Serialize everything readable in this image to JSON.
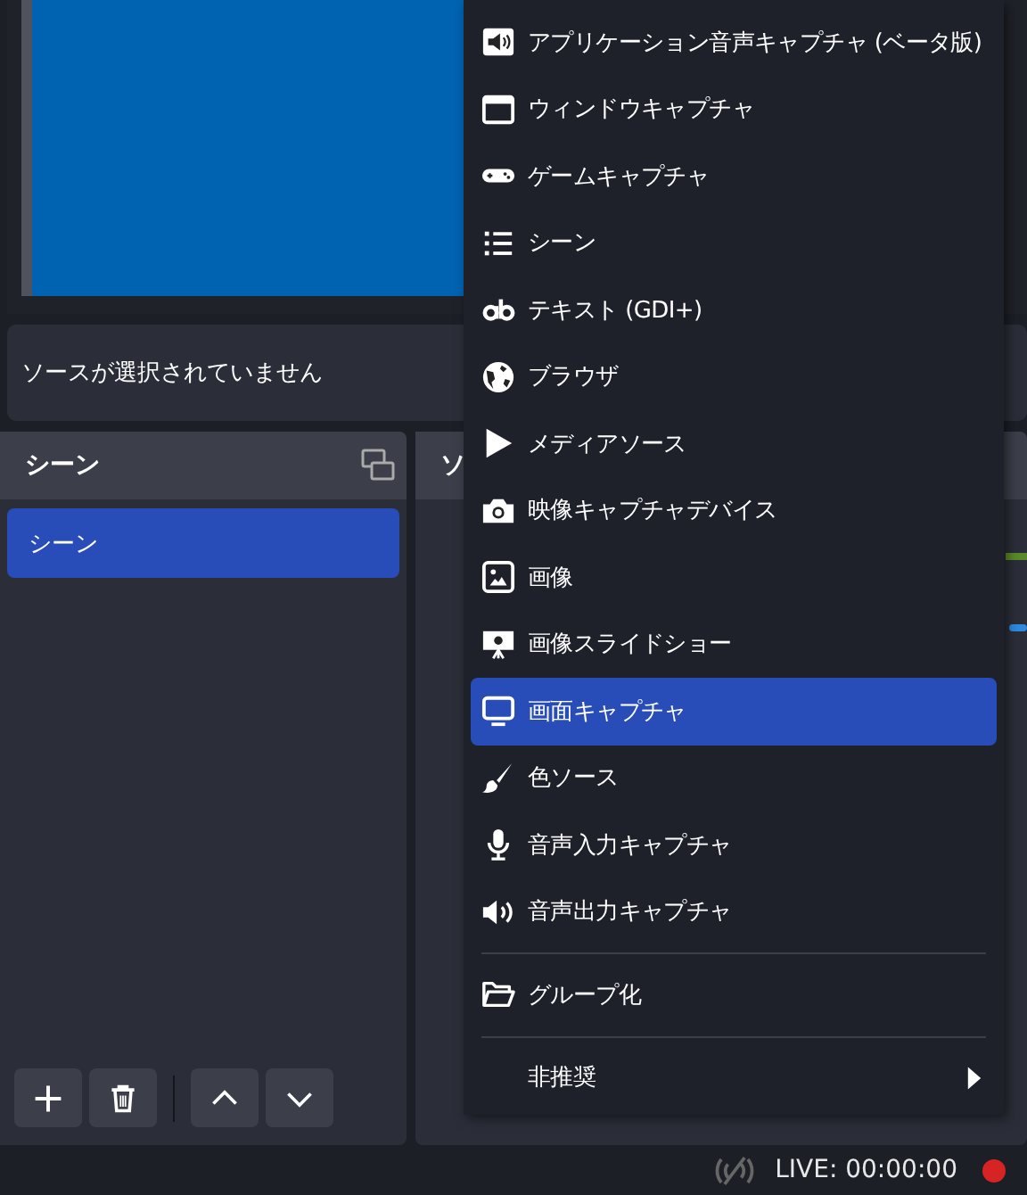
{
  "source_status": "ソースが選択されていません",
  "scenes_panel": {
    "title": "シーン",
    "items": [
      {
        "label": "シーン",
        "selected": true
      }
    ]
  },
  "sources_panel": {
    "title": "ソ"
  },
  "context_menu": {
    "items": [
      {
        "kind": "item",
        "label": "アプリケーション音声キャプチャ (ベータ版)",
        "selected": false
      },
      {
        "kind": "item",
        "label": "ウィンドウキャプチャ",
        "selected": false
      },
      {
        "kind": "item",
        "label": "ゲームキャプチャ",
        "selected": false
      },
      {
        "kind": "item",
        "label": "シーン",
        "selected": false
      },
      {
        "kind": "item",
        "label": "テキスト (GDI+)",
        "selected": false
      },
      {
        "kind": "item",
        "label": "ブラウザ",
        "selected": false
      },
      {
        "kind": "item",
        "label": "メディアソース",
        "selected": false
      },
      {
        "kind": "item",
        "label": "映像キャプチャデバイス",
        "selected": false
      },
      {
        "kind": "item",
        "label": "画像",
        "selected": false
      },
      {
        "kind": "item",
        "label": "画像スライドショー",
        "selected": false
      },
      {
        "kind": "item",
        "label": "画面キャプチャ",
        "selected": true
      },
      {
        "kind": "item",
        "label": "色ソース",
        "selected": false
      },
      {
        "kind": "item",
        "label": "音声入力キャプチャ",
        "selected": false
      },
      {
        "kind": "item",
        "label": "音声出力キャプチャ",
        "selected": false
      },
      {
        "kind": "separator"
      },
      {
        "kind": "item",
        "label": "グループ化",
        "selected": false
      },
      {
        "kind": "separator"
      },
      {
        "kind": "submenu",
        "label": "非推奨",
        "selected": false
      }
    ]
  },
  "status_bar": {
    "live": "LIVE: 00:00:00"
  }
}
